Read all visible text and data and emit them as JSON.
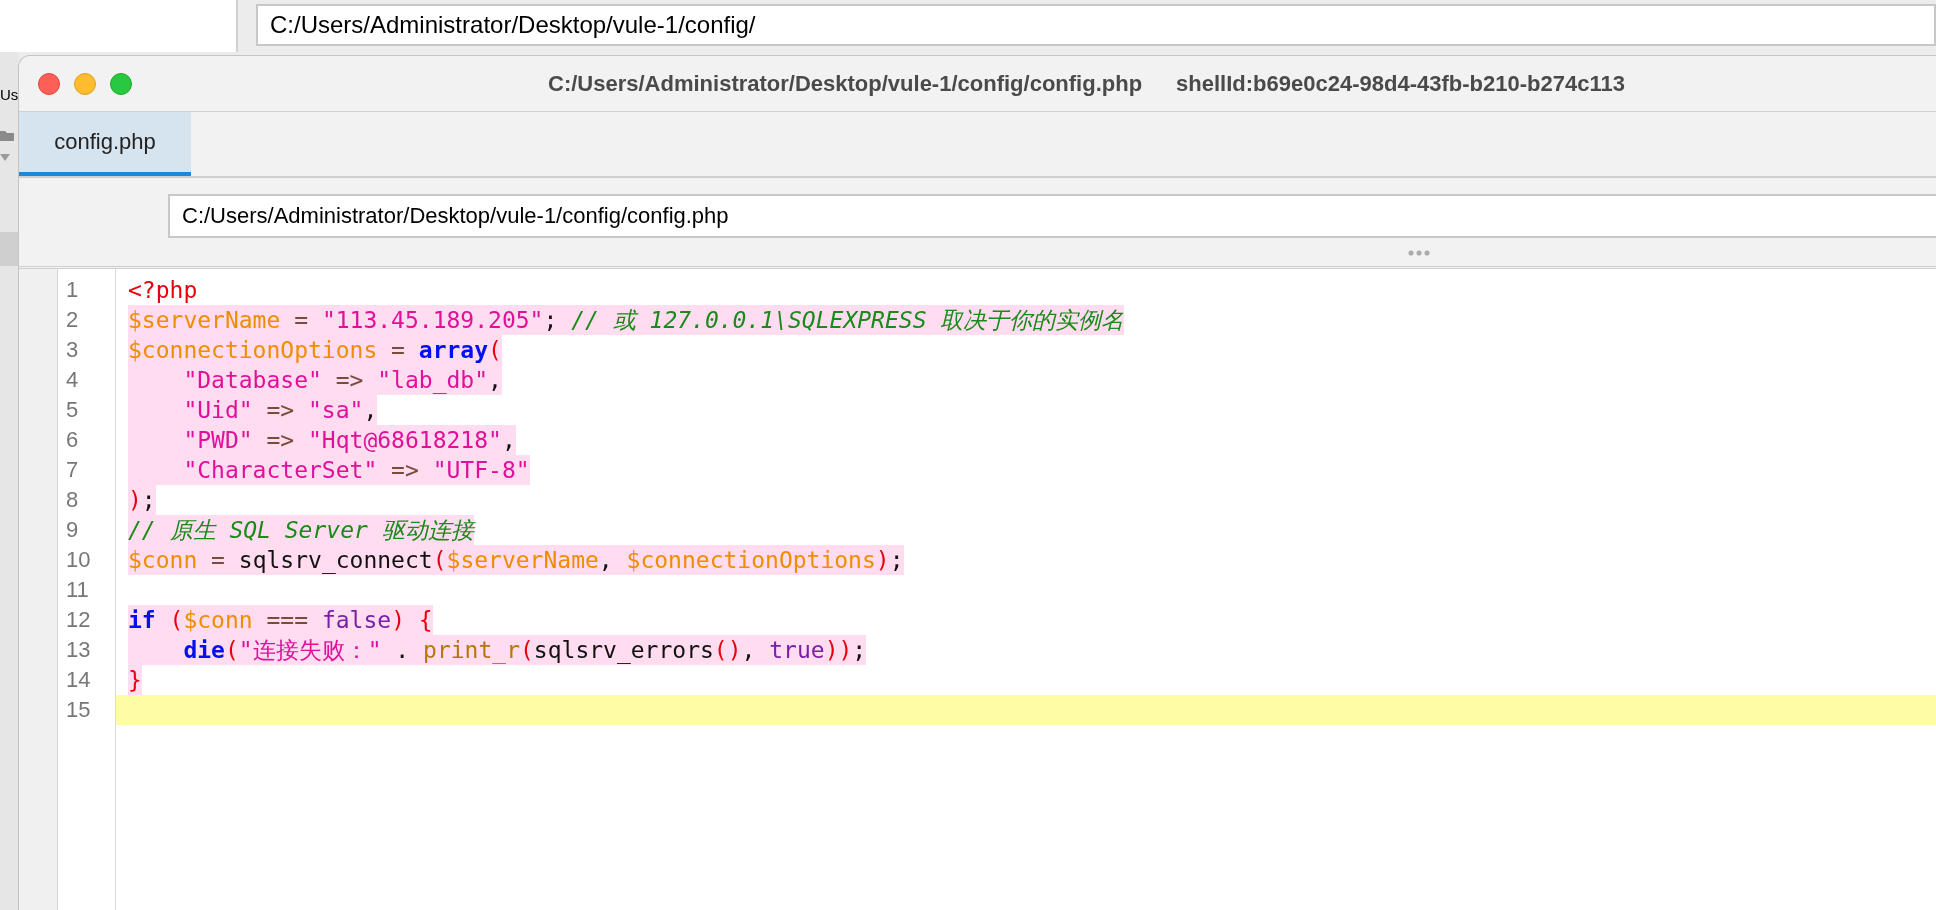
{
  "background_window": {
    "path_field": {
      "value": "C:/Users/Administrator/Desktop/vule-1/config/"
    },
    "sidebar_label": "Us"
  },
  "window": {
    "title": "C:/Users/Administrator/Desktop/vule-1/config/config.php",
    "shell_id": "shellId:b69e0c24-98d4-43fb-b210-b274c113"
  },
  "tabs": [
    {
      "label": "config.php",
      "selected": true
    }
  ],
  "path_field": {
    "value": "C:/Users/Administrator/Desktop/vule-1/config/config.php"
  },
  "editor": {
    "lines": [
      {
        "number": "1",
        "highlighted": false,
        "current": false,
        "tokens": [
          {
            "kind": "tag",
            "text": "<?php"
          }
        ]
      },
      {
        "number": "2",
        "highlighted": true,
        "current": false,
        "tokens": [
          {
            "kind": "variable",
            "text": "$serverName"
          },
          {
            "kind": "operator",
            "text": " = "
          },
          {
            "kind": "string",
            "text": "\"113.45.189.205\""
          },
          {
            "kind": "plain",
            "text": "; "
          },
          {
            "kind": "comment",
            "text": "// 或 127.0.0.1\\SQLEXPRESS 取决于你的实例名"
          }
        ]
      },
      {
        "number": "3",
        "highlighted": true,
        "current": false,
        "tokens": [
          {
            "kind": "variable",
            "text": "$connectionOptions"
          },
          {
            "kind": "operator",
            "text": " = "
          },
          {
            "kind": "keyword",
            "text": "array"
          },
          {
            "kind": "paren",
            "text": "("
          }
        ]
      },
      {
        "number": "4",
        "highlighted": true,
        "current": false,
        "tokens": [
          {
            "kind": "string",
            "text": "    \"Database\""
          },
          {
            "kind": "operator",
            "text": " => "
          },
          {
            "kind": "string",
            "text": "\"lab_db\""
          },
          {
            "kind": "plain",
            "text": ","
          }
        ]
      },
      {
        "number": "5",
        "highlighted": true,
        "current": false,
        "tokens": [
          {
            "kind": "string",
            "text": "    \"Uid\""
          },
          {
            "kind": "operator",
            "text": " => "
          },
          {
            "kind": "string",
            "text": "\"sa\""
          },
          {
            "kind": "plain",
            "text": ","
          }
        ]
      },
      {
        "number": "6",
        "highlighted": true,
        "current": false,
        "tokens": [
          {
            "kind": "string",
            "text": "    \"PWD\""
          },
          {
            "kind": "operator",
            "text": " => "
          },
          {
            "kind": "string",
            "text": "\"Hqt@68618218\""
          },
          {
            "kind": "plain",
            "text": ","
          }
        ]
      },
      {
        "number": "7",
        "highlighted": true,
        "current": false,
        "tokens": [
          {
            "kind": "string",
            "text": "    \"CharacterSet\""
          },
          {
            "kind": "operator",
            "text": " => "
          },
          {
            "kind": "string",
            "text": "\"UTF-8\""
          }
        ]
      },
      {
        "number": "8",
        "highlighted": true,
        "current": false,
        "tokens": [
          {
            "kind": "paren",
            "text": ")"
          },
          {
            "kind": "plain",
            "text": ";"
          }
        ]
      },
      {
        "number": "9",
        "highlighted": true,
        "current": false,
        "tokens": [
          {
            "kind": "comment",
            "text": "// 原生 SQL Server 驱动连接"
          }
        ]
      },
      {
        "number": "10",
        "highlighted": true,
        "current": false,
        "tokens": [
          {
            "kind": "variable",
            "text": "$conn"
          },
          {
            "kind": "operator",
            "text": " = "
          },
          {
            "kind": "plain",
            "text": "sqlsrv_connect"
          },
          {
            "kind": "paren",
            "text": "("
          },
          {
            "kind": "variable",
            "text": "$serverName"
          },
          {
            "kind": "plain",
            "text": ", "
          },
          {
            "kind": "variable",
            "text": "$connectionOptions"
          },
          {
            "kind": "paren",
            "text": ")"
          },
          {
            "kind": "plain",
            "text": ";"
          }
        ]
      },
      {
        "number": "11"
      },
      {
        "number": "12",
        "highlighted": true,
        "current": false,
        "tokens": [
          {
            "kind": "keyword",
            "text": "if"
          },
          {
            "kind": "paren",
            "text": " ("
          },
          {
            "kind": "variable",
            "text": "$conn"
          },
          {
            "kind": "operator",
            "text": " === "
          },
          {
            "kind": "bool",
            "text": "false"
          },
          {
            "kind": "paren",
            "text": ") {"
          }
        ]
      },
      {
        "number": "13",
        "highlighted": true,
        "current": false,
        "tokens": [
          {
            "kind": "keyword",
            "text": "    die"
          },
          {
            "kind": "paren",
            "text": "("
          },
          {
            "kind": "string",
            "text": "\"连接失败：\""
          },
          {
            "kind": "plain",
            "text": " . "
          },
          {
            "kind": "func",
            "text": "print_r"
          },
          {
            "kind": "paren",
            "text": "("
          },
          {
            "kind": "plain",
            "text": "sqlsrv_errors"
          },
          {
            "kind": "paren",
            "text": "()"
          },
          {
            "kind": "plain",
            "text": ", "
          },
          {
            "kind": "bool",
            "text": "true"
          },
          {
            "kind": "paren",
            "text": "))"
          },
          {
            "kind": "plain",
            "text": ";"
          }
        ]
      },
      {
        "number": "14",
        "highlighted": true,
        "current": false,
        "tokens": [
          {
            "kind": "paren",
            "text": "}"
          }
        ]
      },
      {
        "number": "15",
        "current": true
      }
    ]
  }
}
